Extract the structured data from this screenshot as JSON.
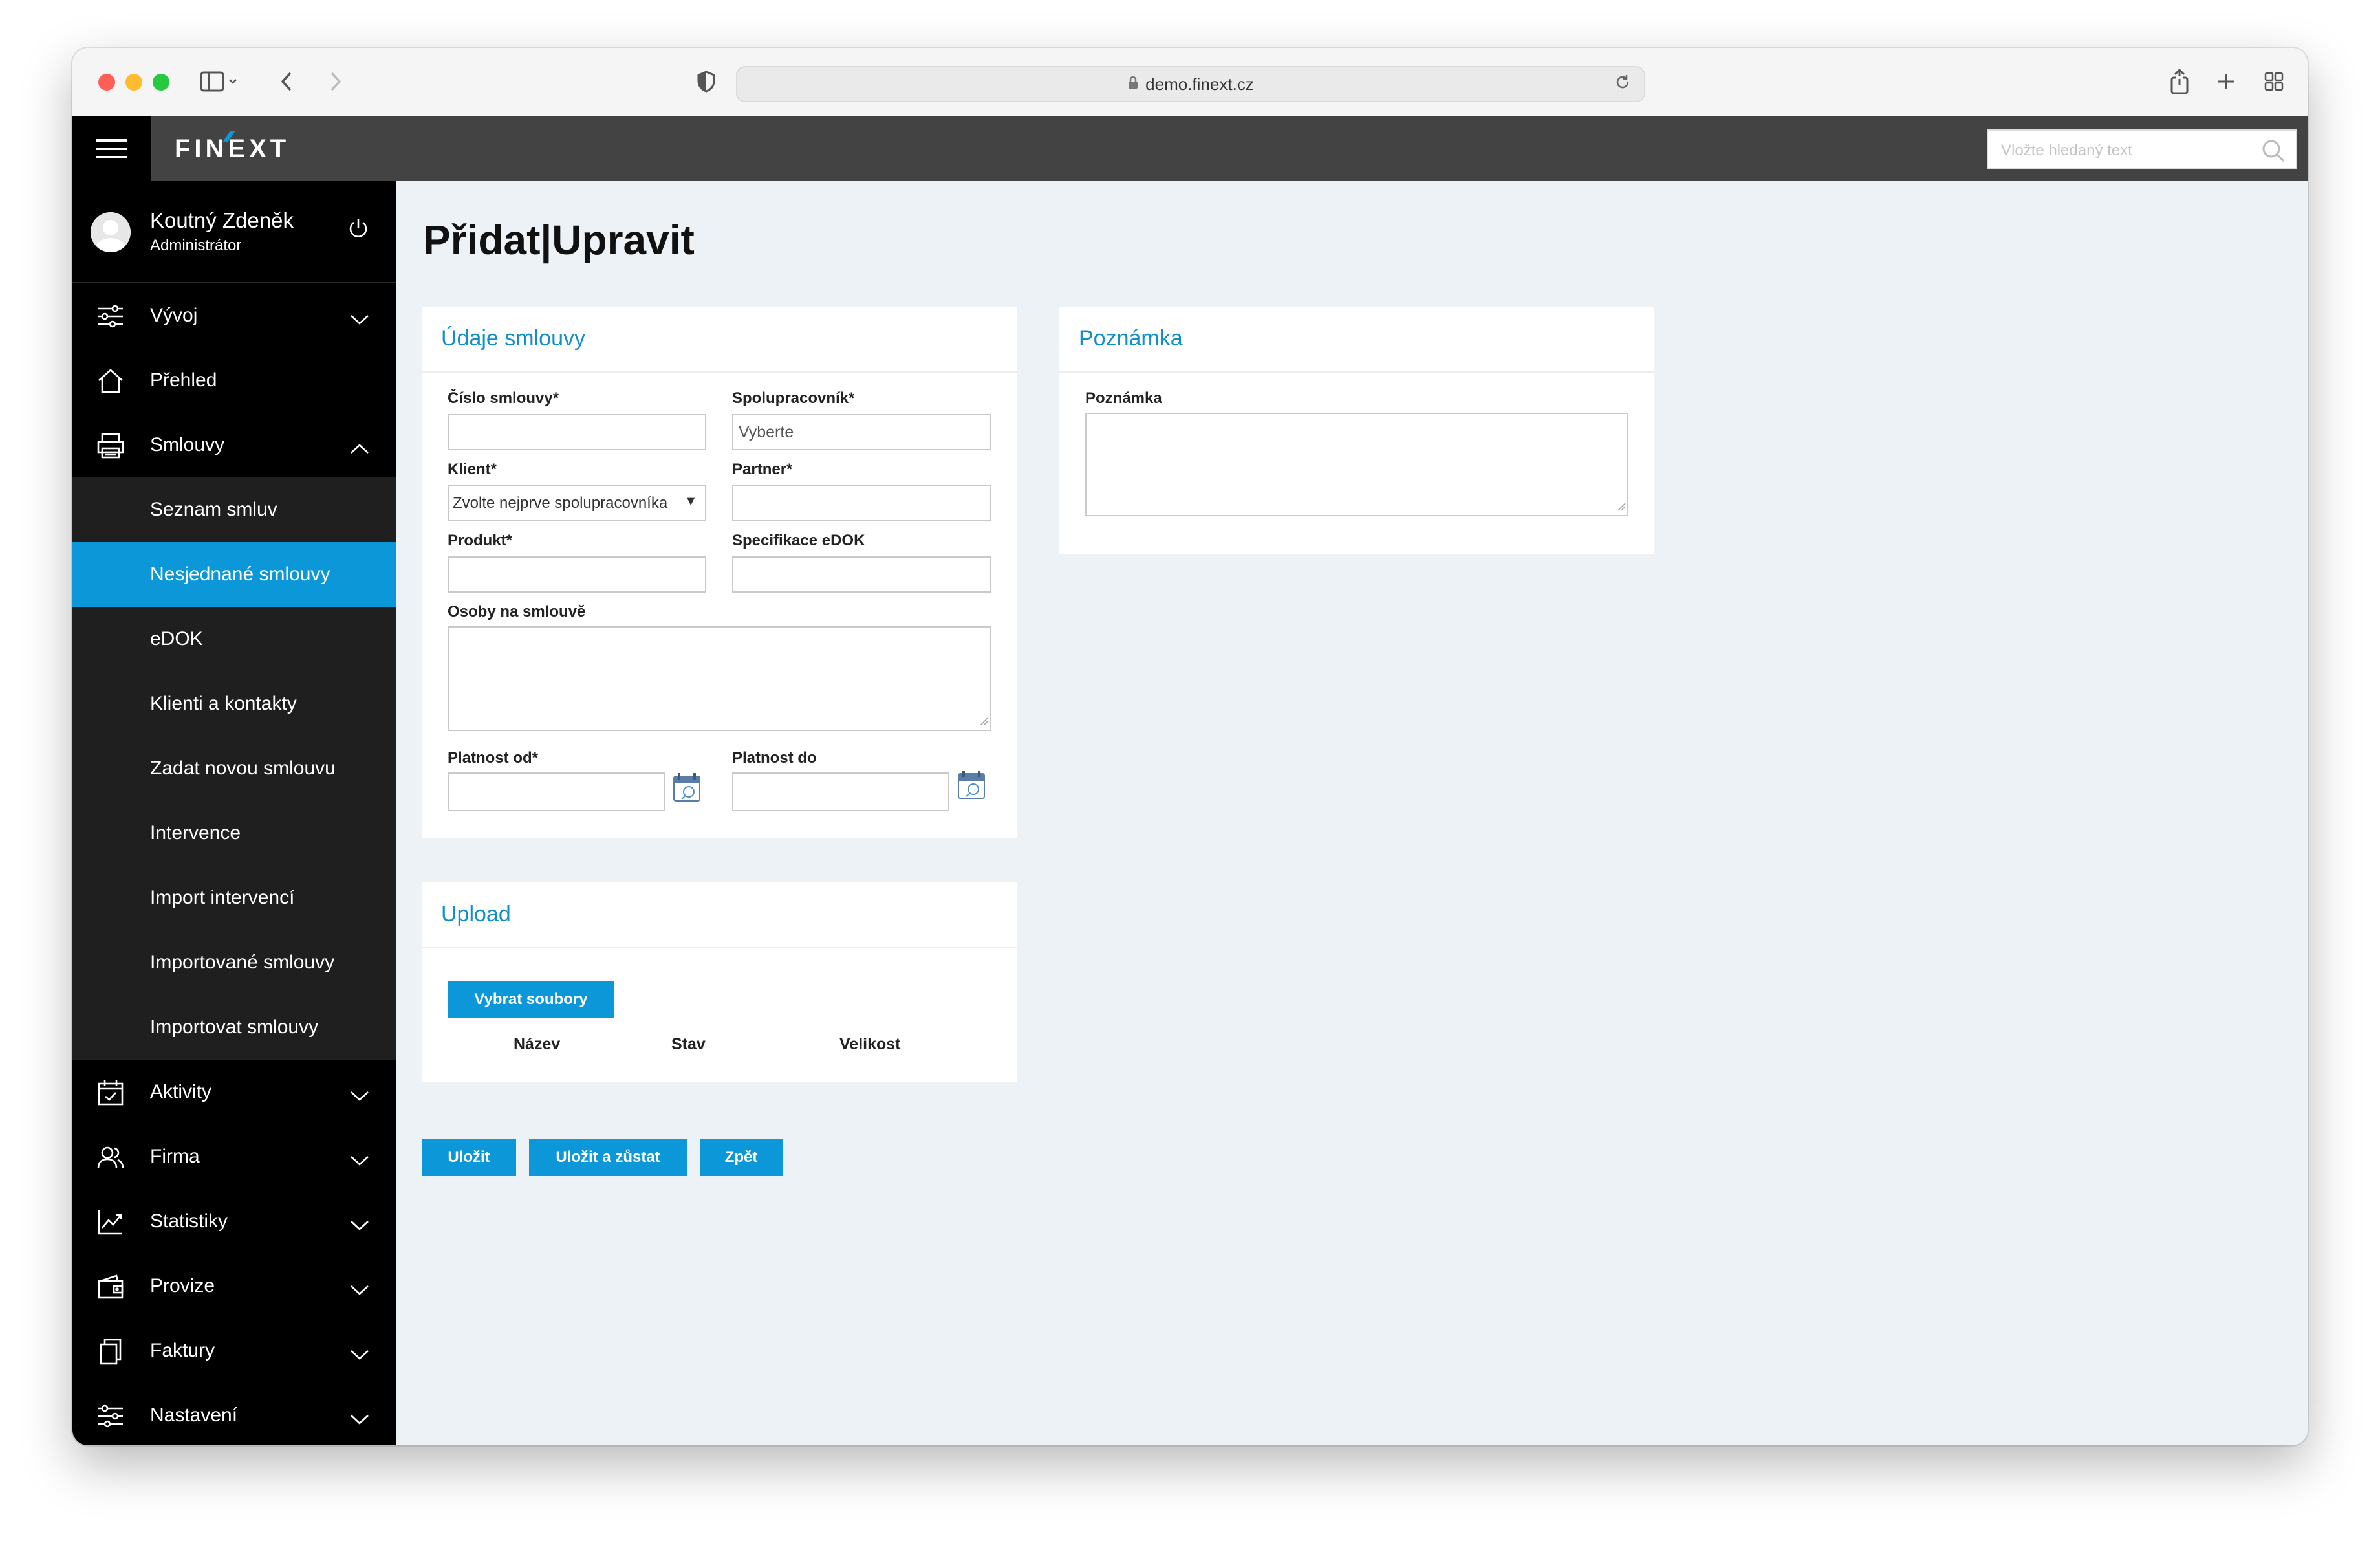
{
  "browser": {
    "url": "demo.finext.cz"
  },
  "header": {
    "logo_text": "FINEXT",
    "search_placeholder": "Vložte hledaný text"
  },
  "user": {
    "name": "Koutný Zdeněk",
    "role": "Administrátor"
  },
  "sidebar": {
    "items": [
      {
        "label": "Vývoj",
        "icon": "sliders-icon",
        "expandable": true
      },
      {
        "label": "Přehled",
        "icon": "home-icon",
        "expandable": false
      },
      {
        "label": "Smlouvy",
        "icon": "printer-icon",
        "expandable": true,
        "expanded": true
      },
      {
        "label": "Seznam smluv"
      },
      {
        "label": "Nesjednané smlouvy",
        "active": true
      },
      {
        "label": "eDOK"
      },
      {
        "label": "Klienti a kontakty"
      },
      {
        "label": "Zadat novou smlouvu"
      },
      {
        "label": "Intervence"
      },
      {
        "label": "Import intervencí"
      },
      {
        "label": "Importované smlouvy"
      },
      {
        "label": "Importovat smlouvy"
      },
      {
        "label": "Aktivity",
        "icon": "calendar-check-icon",
        "expandable": true
      },
      {
        "label": "Firma",
        "icon": "users-icon",
        "expandable": true
      },
      {
        "label": "Statistiky",
        "icon": "chart-line-icon",
        "expandable": true
      },
      {
        "label": "Provize",
        "icon": "wallet-icon",
        "expandable": true
      },
      {
        "label": "Faktury",
        "icon": "copy-icon",
        "expandable": true
      },
      {
        "label": "Nastavení",
        "icon": "settings-sliders-icon",
        "expandable": true
      }
    ]
  },
  "page": {
    "title": "Přidat|Upravit"
  },
  "contract_panel": {
    "title": "Údaje smlouvy",
    "contract_number_label": "Číslo smlouvy",
    "partner_collab_label": "Spolupracovník",
    "partner_collab_placeholder": "Vyberte",
    "client_label": "Klient",
    "client_select_value": "Zvolte nejprve spolupracovníka",
    "partner_label": "Partner",
    "product_label": "Produkt",
    "edok_spec_label": "Specifikace eDOK",
    "persons_label": "Osoby na smlouvě",
    "valid_from_label": "Platnost od",
    "valid_to_label": "Platnost do",
    "required_mark": "*"
  },
  "note_panel": {
    "title": "Poznámka",
    "note_label": "Poznámka"
  },
  "upload_panel": {
    "title": "Upload",
    "select_files_button": "Vybrat soubory",
    "columns": [
      "Název",
      "Stav",
      "Velikost"
    ]
  },
  "actions": {
    "save": "Uložit",
    "save_stay": "Uložit a zůstat",
    "back": "Zpět"
  },
  "colors": {
    "accent": "#0c98d8",
    "header_bg": "#434343",
    "sidebar_bg": "#000000",
    "content_bg": "#ecf2f5"
  }
}
